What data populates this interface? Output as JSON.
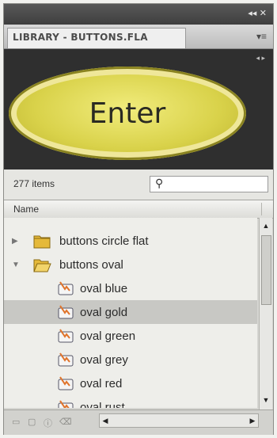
{
  "window": {
    "controls": "◂◂  ✕"
  },
  "tab": {
    "title": "LIBRARY - BUTTONS.FLA",
    "menu_icon": "panel-menu-icon"
  },
  "preview": {
    "button_label": "Enter",
    "nav_arrows": "◂ ▸"
  },
  "toolbar": {
    "item_count": "277 items",
    "search_placeholder": ""
  },
  "columns": {
    "name": "Name"
  },
  "tree": [
    {
      "label": "buttons circle flat",
      "type": "folder-closed",
      "selected": false
    },
    {
      "label": "buttons oval",
      "type": "folder-open",
      "selected": false
    },
    {
      "label": "oval blue",
      "type": "button-symbol",
      "selected": false
    },
    {
      "label": "oval gold",
      "type": "button-symbol",
      "selected": true
    },
    {
      "label": "oval green",
      "type": "button-symbol",
      "selected": false
    },
    {
      "label": "oval grey",
      "type": "button-symbol",
      "selected": false
    },
    {
      "label": "oval red",
      "type": "button-symbol",
      "selected": false
    },
    {
      "label": "oval rust",
      "type": "button-symbol",
      "selected": false
    }
  ],
  "colors": {
    "preview_bg": "#2f2f2f",
    "oval_fill": "#d9d24a",
    "selection": "#c8c8c4"
  }
}
